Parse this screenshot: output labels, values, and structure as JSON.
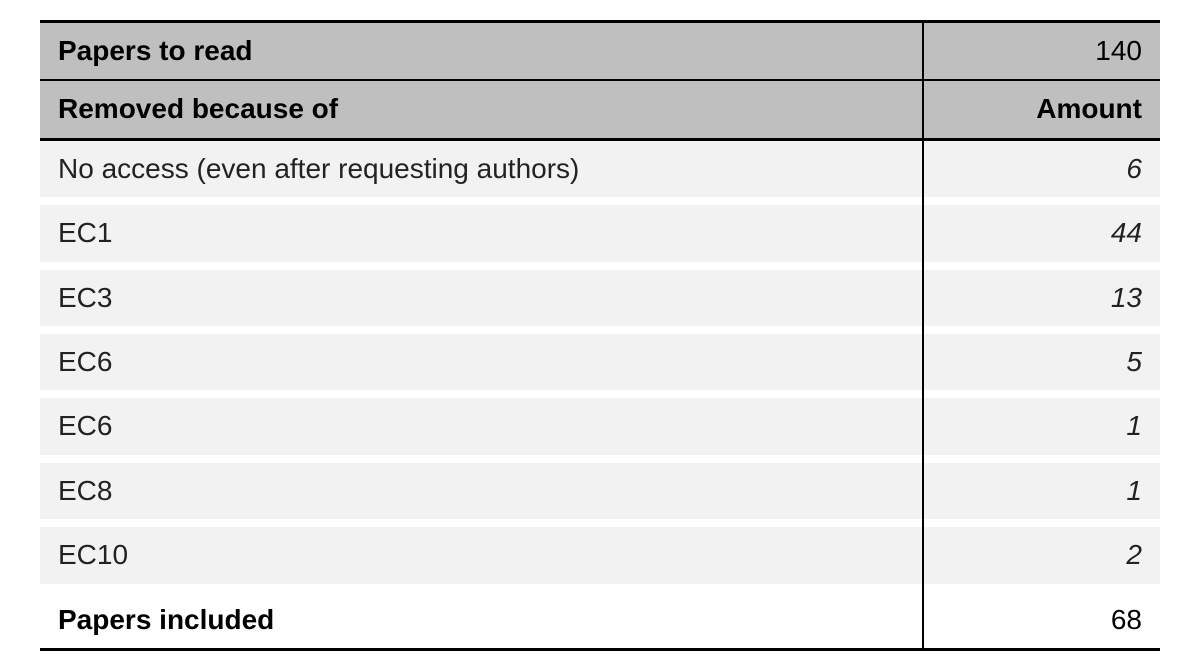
{
  "chart_data": {
    "type": "table",
    "title": "Papers to read",
    "total_to_read": 140,
    "removed_header_label": "Removed because of",
    "removed_header_value": "Amount",
    "removed": [
      {
        "reason": "No access (even after requesting authors)",
        "amount": 6
      },
      {
        "reason": "EC1",
        "amount": 44
      },
      {
        "reason": "EC3",
        "amount": 13
      },
      {
        "reason": "EC6",
        "amount": 5
      },
      {
        "reason": "EC6",
        "amount": 1
      },
      {
        "reason": "EC8",
        "amount": 1
      },
      {
        "reason": "EC10",
        "amount": 2
      }
    ],
    "footer_label": "Papers included",
    "footer_value": 68
  }
}
